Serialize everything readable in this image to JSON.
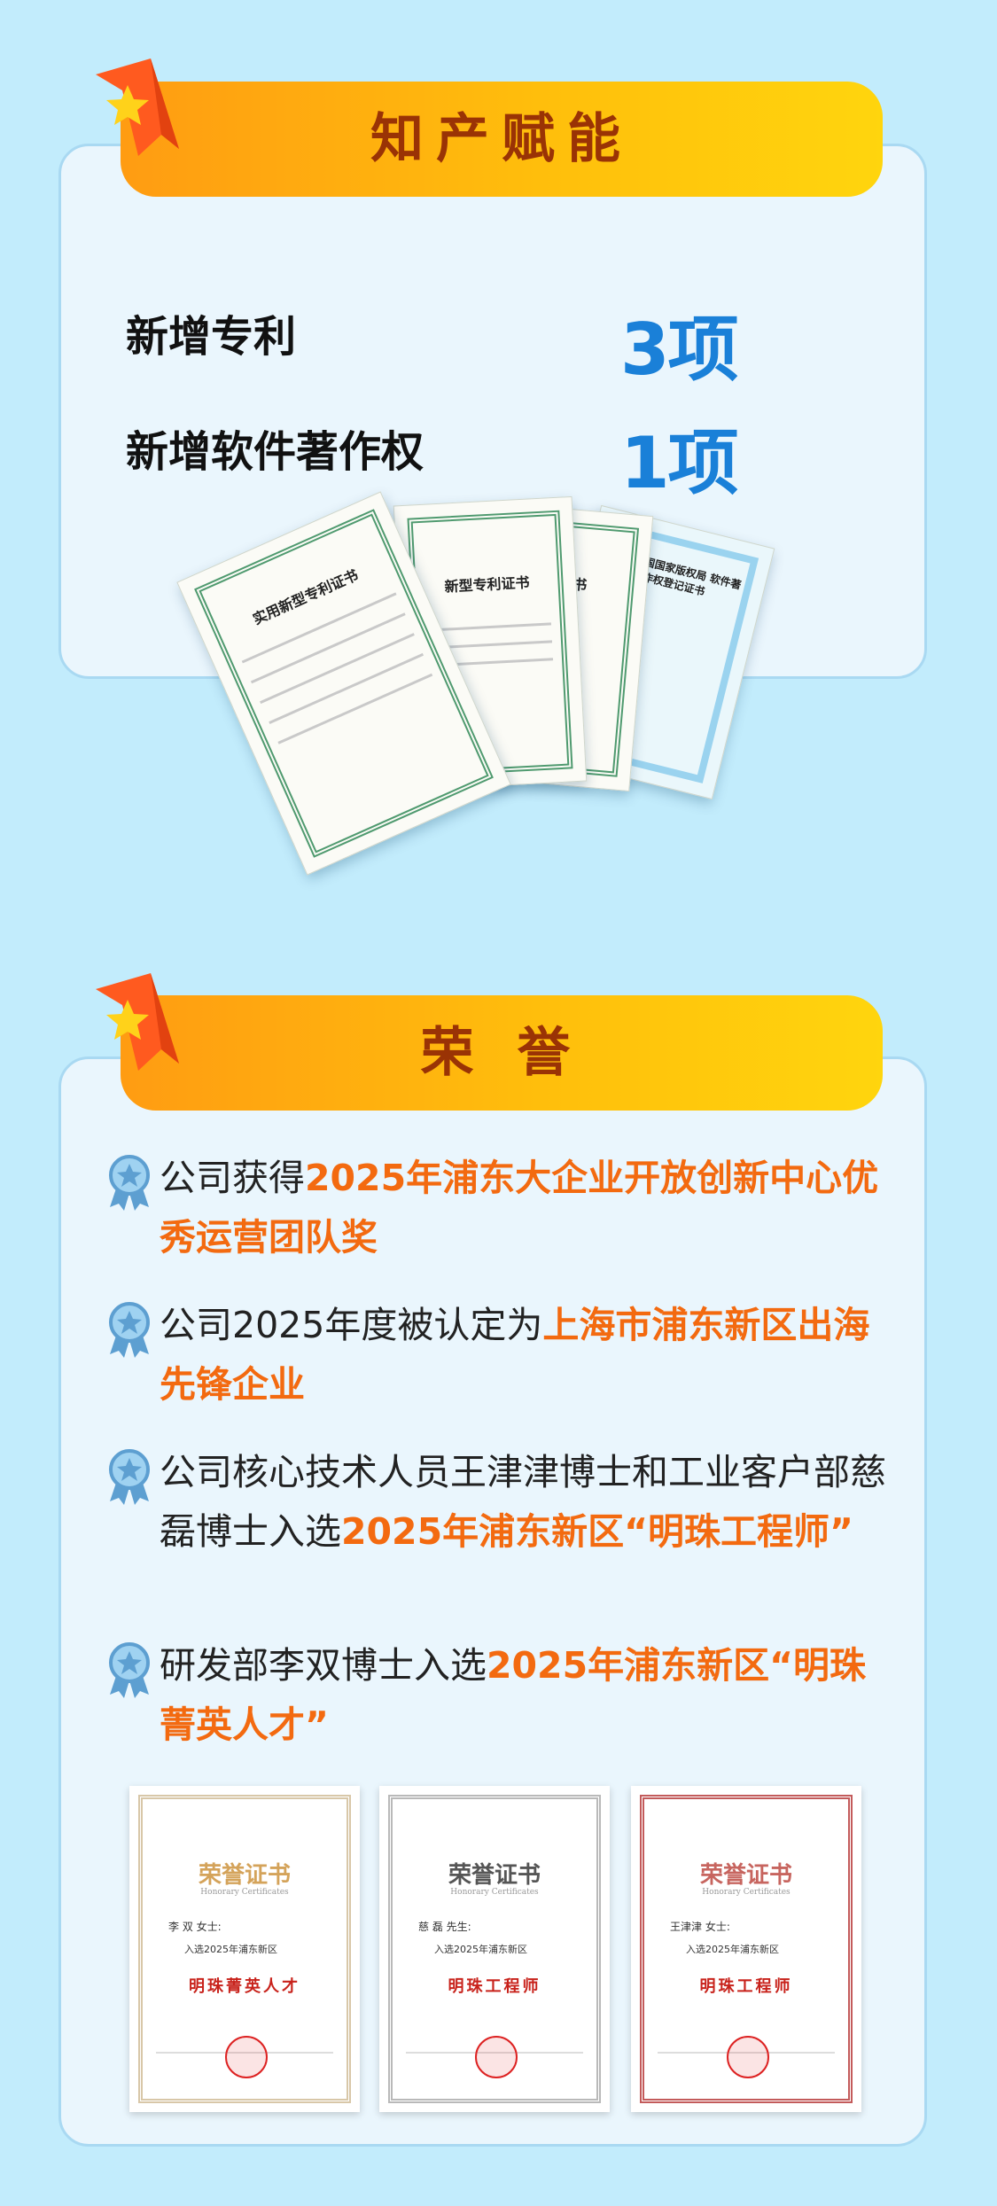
{
  "section1": {
    "title": "知产赋能",
    "stats": [
      {
        "label": "新增专利",
        "value": "3项"
      },
      {
        "label": "新增软件著作权",
        "value": "1项"
      }
    ],
    "certificates": [
      {
        "title": "实用新型专利证书"
      },
      {
        "title": "新型专利证书"
      },
      {
        "title": "书"
      },
      {
        "title": "民共和国国家版权局 软件著作权登记证书"
      }
    ]
  },
  "section2": {
    "title": "荣 誉",
    "honors": [
      {
        "plain": "公司获得",
        "highlight": "2025年浦东大企业开放创新中心优秀运营团队奖"
      },
      {
        "plain": "公司2025年度被认定为",
        "highlight": "上海市浦东新区出海先锋企业"
      },
      {
        "plain": "公司核心技术人员王津津博士和工业客户部慈磊博士入选",
        "highlight": "2025年浦东新区“明珠工程师”"
      },
      {
        "plain": "研发部李双博士入选",
        "highlight": "2025年浦东新区“明珠菁英人才”"
      }
    ],
    "honor_certificates": [
      {
        "title": "荣誉证书",
        "subtitle": "Honorary Certificates",
        "name": "李 双 女士:",
        "line": "入选2025年浦东新区",
        "award": "明珠菁英人才"
      },
      {
        "title": "荣誉证书",
        "subtitle": "Honorary Certificates",
        "name": "慈 磊 先生:",
        "line": "入选2025年浦东新区",
        "award": "明珠工程师"
      },
      {
        "title": "荣誉证书",
        "subtitle": "Honorary Certificates",
        "name": "王津津 女士:",
        "line": "入选2025年浦东新区",
        "award": "明珠工程师"
      }
    ]
  },
  "colors": {
    "background": "#c2ecfc",
    "accent_orange": "#f36a10",
    "stat_blue": "#1a80d8",
    "banner_text": "#9a3305"
  }
}
